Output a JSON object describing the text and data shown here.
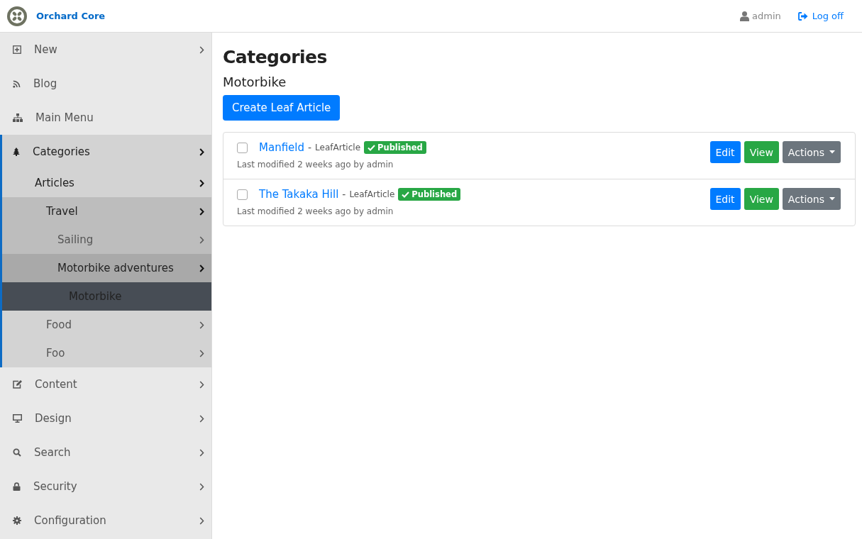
{
  "brand": {
    "name": "Orchard Core"
  },
  "user": {
    "name": "admin",
    "logoff": "Log off"
  },
  "sidebar": {
    "items": [
      {
        "label": "New",
        "has_submenu": true,
        "expanded": false,
        "selected": false
      },
      {
        "label": "Blog",
        "has_submenu": false,
        "expanded": false,
        "selected": false
      },
      {
        "label": "Main Menu",
        "has_submenu": false,
        "expanded": false,
        "selected": false
      },
      {
        "label": "Categories",
        "has_submenu": true,
        "expanded": true,
        "selected": false,
        "children": [
          {
            "label": "Articles",
            "has_submenu": true,
            "expanded": true,
            "selected": false,
            "children": [
              {
                "label": "Travel",
                "has_submenu": true,
                "expanded": true,
                "selected": false,
                "children": [
                  {
                    "label": "Sailing",
                    "has_submenu": true,
                    "expanded": false,
                    "selected": false
                  },
                  {
                    "label": "Motorbike adventures",
                    "has_submenu": true,
                    "expanded": true,
                    "selected": false,
                    "children": [
                      {
                        "label": "Motorbike",
                        "has_submenu": false,
                        "expanded": false,
                        "selected": true
                      }
                    ]
                  }
                ]
              },
              {
                "label": "Food",
                "has_submenu": true,
                "expanded": false,
                "selected": false
              },
              {
                "label": "Foo",
                "has_submenu": true,
                "expanded": false,
                "selected": false
              }
            ]
          }
        ]
      },
      {
        "label": "Content",
        "has_submenu": true,
        "expanded": false,
        "selected": false
      },
      {
        "label": "Design",
        "has_submenu": true,
        "expanded": false,
        "selected": false
      },
      {
        "label": "Search",
        "has_submenu": true,
        "expanded": false,
        "selected": false
      },
      {
        "label": "Security",
        "has_submenu": true,
        "expanded": false,
        "selected": false
      },
      {
        "label": "Configuration",
        "has_submenu": true,
        "expanded": false,
        "selected": false
      }
    ]
  },
  "page": {
    "title": "Categories",
    "subtitle": "Motorbike",
    "create_button": "Create Leaf Article"
  },
  "items": [
    {
      "title": "Manfield",
      "separator": "-",
      "type": "LeafArticle",
      "status": "Published",
      "checked": false,
      "meta": "Last modified 2 weeks ago by admin",
      "buttons": [
        "Edit",
        "View",
        "Actions"
      ]
    },
    {
      "title": "The Takaka Hill",
      "separator": "-",
      "type": "LeafArticle",
      "status": "Published",
      "checked": false,
      "meta": "Last modified 2 weeks ago by admin",
      "buttons": [
        "Edit",
        "View",
        "Actions"
      ]
    }
  ]
}
